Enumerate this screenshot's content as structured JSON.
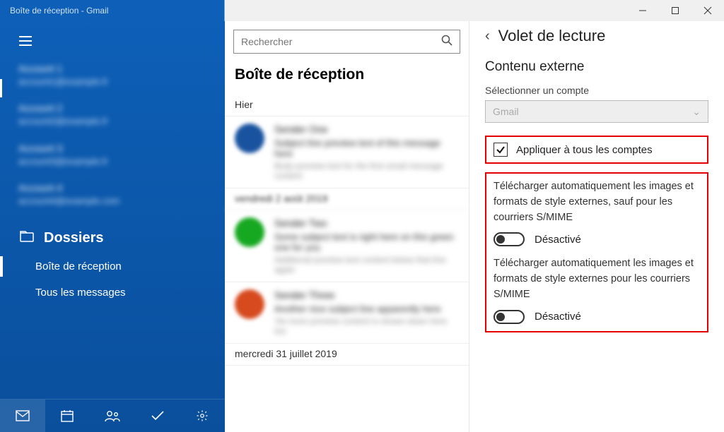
{
  "window": {
    "title": "Boîte de réception - Gmail"
  },
  "sidebar": {
    "section_label": "Dossiers",
    "folders": [
      {
        "label": "Boîte de réception",
        "selected": true
      },
      {
        "label": "Tous les messages",
        "selected": false
      }
    ]
  },
  "accounts_list": [
    {
      "name": "Account 1",
      "email": "account1@example.fr"
    },
    {
      "name": "Account 2",
      "email": "account2@example.fr"
    },
    {
      "name": "Account 3",
      "email": "account3@example.fr"
    },
    {
      "name": "Account 4",
      "email": "account4@example.com"
    }
  ],
  "messages": {
    "search_placeholder": "Rechercher",
    "heading": "Boîte de réception",
    "groups": [
      {
        "label": "Hier",
        "items": [
          {
            "avatar_color": "#1953a0",
            "sender": "Sender One",
            "subject": "Subject line preview text of this message here",
            "preview": "Body preview text for the first email message content"
          }
        ]
      },
      {
        "label": "vendredi 2 août 2019",
        "items": [
          {
            "avatar_color": "#17a821",
            "sender": "Sender Two",
            "subject": "Some subject text is right here on this green one for you",
            "preview": "Additional preview text content below that line again"
          },
          {
            "avatar_color": "#d64a1e",
            "sender": "Sender Three",
            "subject": "Another nice subject line apparently here",
            "preview": "Yet more preview content is shown down here too"
          }
        ]
      },
      {
        "label": "mercredi 31 juillet 2019",
        "items": []
      }
    ]
  },
  "panel": {
    "title": "Volet de lecture",
    "section_title": "Contenu externe",
    "select_label": "Sélectionner un compte",
    "select_value": "Gmail",
    "apply_all_label": "Appliquer à tous les comptes",
    "apply_all_checked": true,
    "settings": [
      {
        "desc": "Télécharger automatiquement les images et formats de style externes, sauf pour les courriers S/MIME",
        "state_label": "Désactivé"
      },
      {
        "desc": "Télécharger automatiquement les images et formats de style externes pour les courriers S/MIME",
        "state_label": "Désactivé"
      }
    ]
  }
}
